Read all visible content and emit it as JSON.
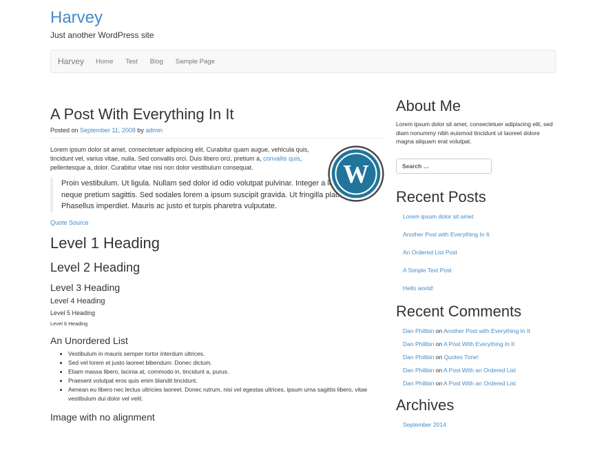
{
  "site": {
    "title": "Harvey",
    "description": "Just another WordPress site"
  },
  "nav": {
    "brand": "Harvey",
    "items": [
      "Home",
      "Test",
      "Blog",
      "Sample Page"
    ]
  },
  "post": {
    "title": "A Post With Everything In It",
    "meta_prefix": "Posted on ",
    "date": "September 11, 2008",
    "meta_by": " by ",
    "author": "admin",
    "intro_before": "Lorem ipsum dolor sit amet, consectetuer adipiscing elit. Curabitur quam augue, vehicula quis, tincidunt vel, varius vitae, nulla. Sed convallis orci. Duis libero orci, pretium a, ",
    "intro_link": "convallis quis",
    "intro_after": ", pellentesque a, dolor. Curabitur vitae nisi non dolor vestibulum consequat.",
    "blockquote": "Proin vestibulum. Ut ligula. Nullam sed dolor id odio volutpat pulvinar. Integer a leo. In et eros at neque pretium sagittis. Sed sodales lorem a ipsum suscipit gravida. Ut fringilla placerat arcu. Phasellus imperdiet. Mauris ac justo et turpis pharetra vulputate.",
    "quote_source": "Quote Source",
    "h1": "Level 1 Heading",
    "h2": "Level 2 Heading",
    "h3": "Level 3 Heading",
    "h4": "Level 4 Heading",
    "h5": "Level 5 Heading",
    "h6": "Level 6 Heading",
    "ul_title": "An Unordered List",
    "ul_items": [
      "Vestibulum in mauris semper tortor interdum ultrices.",
      "Sed vel lorem et justo laoreet bibendum. Donec dictum.",
      "Etiam massa libero, lacinia at, commodo in, tincidunt a, purus.",
      "Praesent volutpat eros quis enim blandit tincidunt.",
      "Aenean eu libero nec lectus ultricies laoreet. Donec rutrum, nisi vel egestas ultrices, ipsum urna sagittis libero, vitae vestibulum dui dolor vel velit."
    ],
    "noalign_title": "Image with no alignment"
  },
  "sidebar": {
    "about_title": "About Me",
    "about_text": "Lorem ipsum dolor sit amet, consectetuer adipiscing elit, sed diam nonummy nibh euismod tincidunt ut laoreet dolore magna aliquam erat volutpat.",
    "search_placeholder": "Search …",
    "recent_posts_title": "Recent Posts",
    "recent_posts": [
      "Lorem ipsum dolor sit amet",
      "Another Post with Everything In It",
      "An Ordered List Post",
      "A Simple Text Post",
      "Hello world!"
    ],
    "recent_comments_title": "Recent Comments",
    "recent_comments": [
      {
        "author": "Dan Philibin",
        "on": " on ",
        "post": "Another Post with Everything In It"
      },
      {
        "author": "Dan Philibin",
        "on": " on ",
        "post": "A Post With Everything In It"
      },
      {
        "author": "Dan Philibin",
        "on": " on ",
        "post": "Quotes Time!"
      },
      {
        "author": "Dan Philibin",
        "on": " on ",
        "post": "A Post With an Ordered List"
      },
      {
        "author": "Dan Philibin",
        "on": " on ",
        "post": "A Post With an Ordered List"
      }
    ],
    "archives_title": "Archives",
    "archives": [
      "September 2014"
    ]
  },
  "colors": {
    "link": "#428bca",
    "text": "#333333",
    "navbar_bg": "#f8f8f8",
    "wp_blue": "#21759b"
  }
}
